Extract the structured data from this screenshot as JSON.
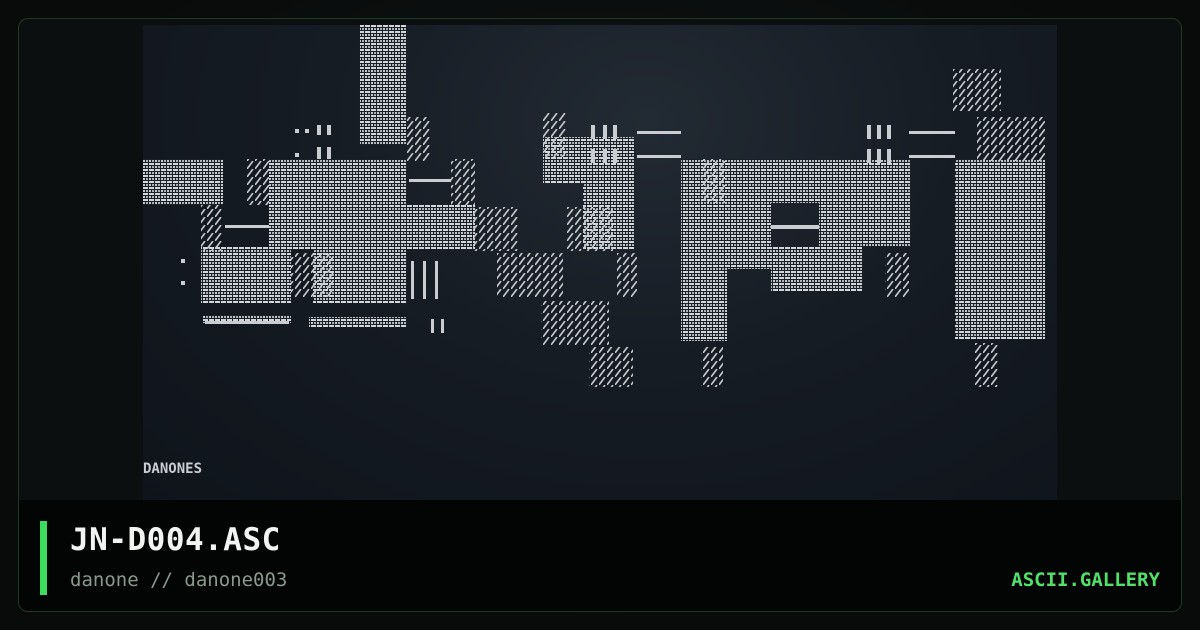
{
  "file": {
    "title": "JN-D004.ASC",
    "subtitle": "danone // danone003"
  },
  "brand": {
    "label": "ASCII.GALLERY"
  },
  "artwork": {
    "signature": "DANONES",
    "colors": {
      "glyph": "#c9ccd0",
      "background": "#161c24",
      "accent": "#3ddc5a"
    }
  }
}
